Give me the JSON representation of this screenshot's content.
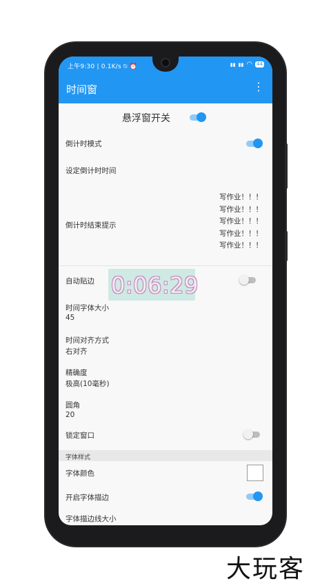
{
  "statusbar": {
    "left": "上午9:30 | 0.1K/s ⍉ ⏰",
    "signal1": "▮▮",
    "signal2": "▮▮",
    "wifi": "◠",
    "battery": "44"
  },
  "appbar": {
    "title": "时间窗",
    "more_icon": "⋮"
  },
  "master_toggle": {
    "label": "悬浮窗开关",
    "on": true
  },
  "settings": {
    "countdown_mode": {
      "label": "倒计时模式",
      "on": true
    },
    "set_countdown_time": {
      "label": "设定倒计时时间"
    },
    "countdown_end_prompt": {
      "label": "倒计时结束提示",
      "lines": [
        "写作业！！！",
        "写作业！！！",
        "写作业！！！",
        "写作业！！！",
        "写作业！！！"
      ]
    },
    "auto_snap": {
      "label": "自动贴边",
      "on": false
    },
    "font_size": {
      "label": "时间字体大小",
      "value": "45"
    },
    "alignment": {
      "label": "时间对齐方式",
      "value": "右对齐"
    },
    "precision": {
      "label": "精确度",
      "value": "极高(10毫秒)"
    },
    "corner": {
      "label": "圆角",
      "value": "20"
    },
    "lock_window": {
      "label": "锁定窗口",
      "on": false
    }
  },
  "font_style_section": {
    "header": "字体样式",
    "font_color": {
      "label": "字体颜色",
      "color": "#ffffff"
    },
    "outline": {
      "label": "开启字体描边",
      "on": true
    },
    "outline_size": {
      "label": "字体描边线大小"
    }
  },
  "floating_timer": {
    "time": "0:06:29"
  },
  "watermark": "大玩客",
  "colors": {
    "accent": "#2196f3",
    "accent_light": "#90caf9"
  }
}
